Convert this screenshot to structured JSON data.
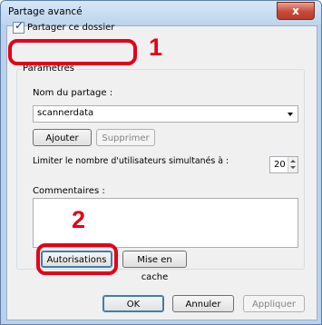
{
  "window": {
    "title": "Partage avancé",
    "close_symbol": "x"
  },
  "share_checkbox": {
    "label": "Partager ce dossier",
    "checked": true
  },
  "params": {
    "group_label": "Paramètres",
    "share_name_label": "Nom du partage :",
    "share_name_value": "scannerdata",
    "add_button": "Ajouter",
    "remove_button": "Supprimer",
    "limit_label": "Limiter le nombre d'utilisateurs simultanés à :",
    "limit_value": "20",
    "comments_label": "Commentaires :",
    "comments_value": "",
    "permissions_button": "Autorisations",
    "cache_button": "Mise en cache"
  },
  "footer": {
    "ok": "OK",
    "cancel": "Annuler",
    "apply": "Appliquer"
  },
  "annotations": {
    "step1": "1",
    "step2": "2",
    "color": "#e3001b"
  }
}
